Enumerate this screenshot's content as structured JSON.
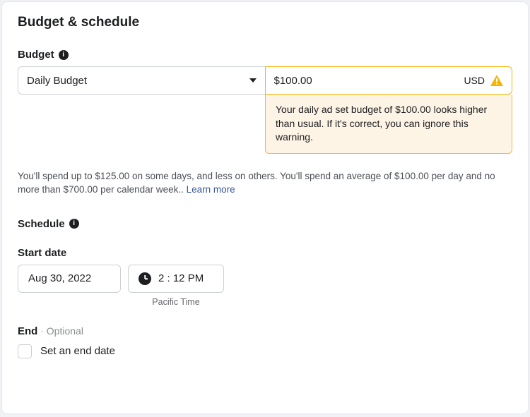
{
  "section_title": "Budget & schedule",
  "budget": {
    "label": "Budget",
    "type_selected": "Daily Budget",
    "amount": "$100.00",
    "currency": "USD",
    "warning_text": "Your daily ad set budget of $100.00 looks higher than usual. If it's correct, you can ignore this warning.",
    "help_text": "You'll spend up to $125.00 on some days, and less on others. You'll spend an average of $100.00 per day and no more than $700.00 per calendar week.. ",
    "learn_more": "Learn more"
  },
  "schedule": {
    "label": "Schedule",
    "start_date_label": "Start date",
    "start_date": "Aug 30, 2022",
    "start_time": "2 : 12 PM",
    "timezone": "Pacific Time",
    "end_label": "End",
    "end_optional": "Optional",
    "set_end_date_label": "Set an end date"
  }
}
